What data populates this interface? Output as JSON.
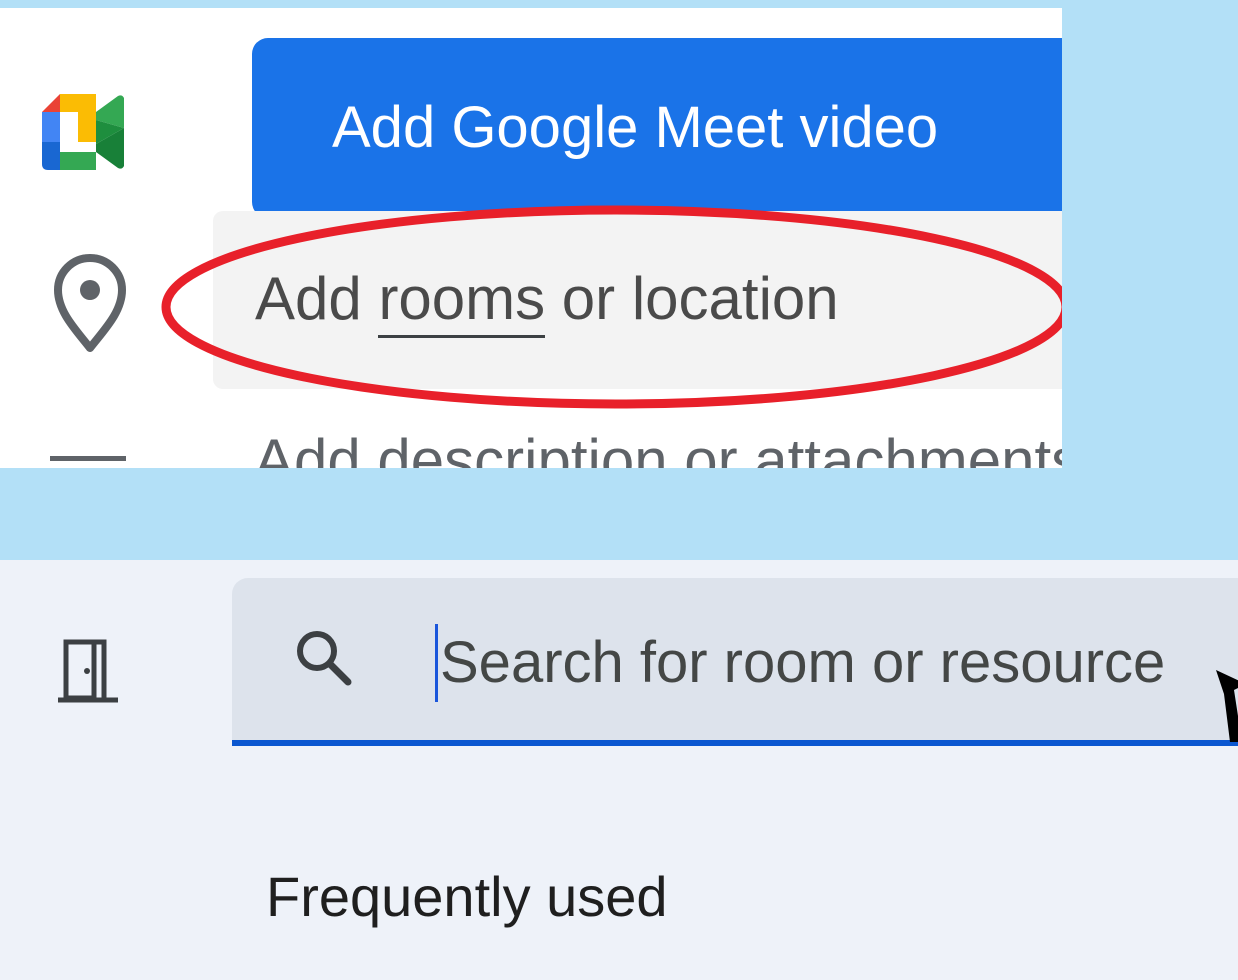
{
  "event_details": {
    "meet_button_label": "Add Google Meet video",
    "location": {
      "prefix": "Add ",
      "underlined_word": "rooms",
      "suffix": " or location"
    },
    "description_placeholder": "Add description or attachments"
  },
  "room_search": {
    "search_placeholder": "Search for room or resource",
    "section_heading": "Frequently used"
  },
  "colors": {
    "background": "#b3e0f7",
    "meet_button": "#1a73e8",
    "highlight": "#e8202a",
    "search_underline": "#0b57d0"
  },
  "icons": {
    "meet": "google-meet-icon",
    "location": "location-pin-icon",
    "description": "notes-icon",
    "room": "meeting-room-icon",
    "search": "search-icon"
  }
}
